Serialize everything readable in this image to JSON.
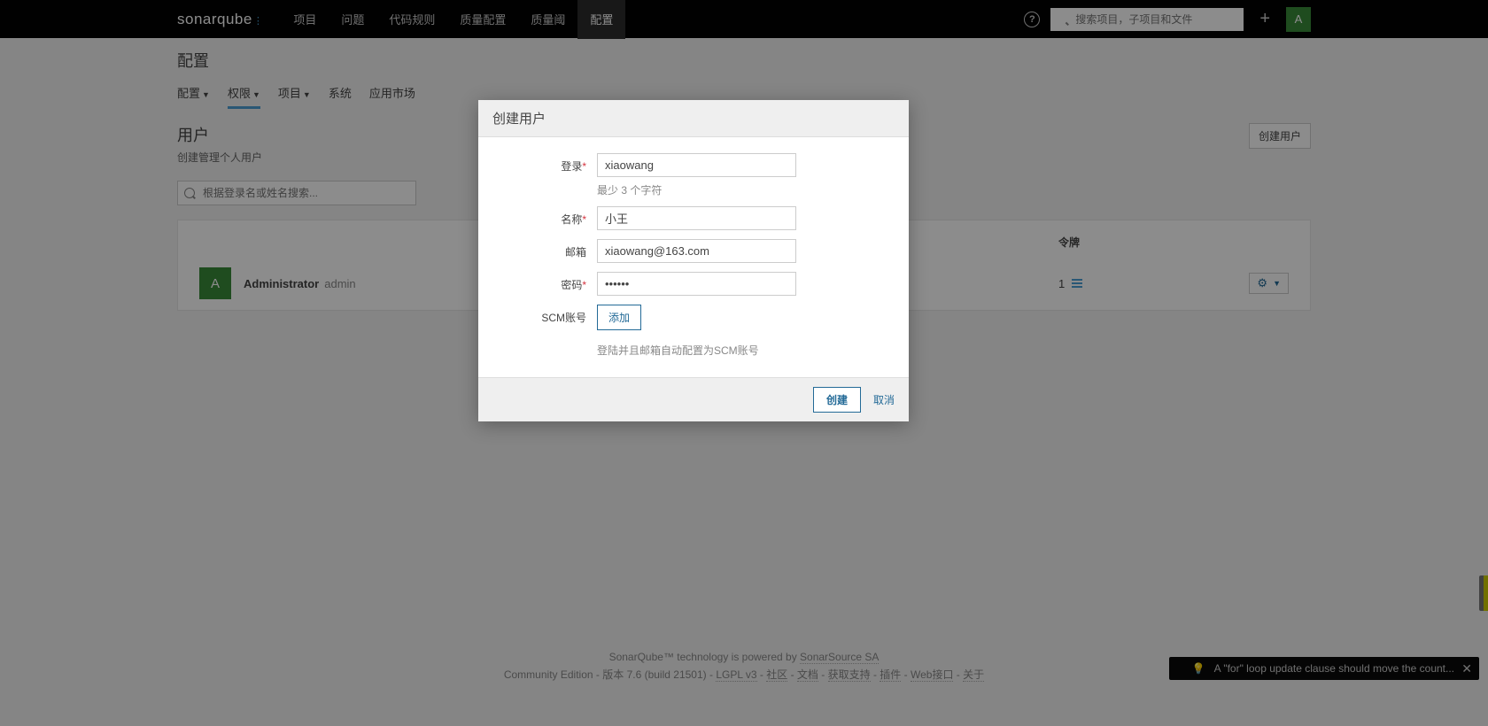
{
  "brand": "sonarqube",
  "nav": {
    "items": [
      "项目",
      "问题",
      "代码规则",
      "质量配置",
      "质量阈",
      "配置"
    ],
    "active_index": 5,
    "search_placeholder": "搜索项目，子项目和文件",
    "avatar_letter": "A"
  },
  "page": {
    "title": "配置",
    "subnav": [
      "配置",
      "权限",
      "项目",
      "系统",
      "应用市场"
    ],
    "subnav_carets": [
      true,
      true,
      true,
      false,
      false
    ],
    "subnav_active": 1
  },
  "users": {
    "heading": "用户",
    "sub": "创建管理个人用户",
    "create_btn": "创建用户",
    "filter_placeholder": "根据登录名或姓名搜索...",
    "col_token": "令牌",
    "row": {
      "avatar": "A",
      "name": "Administrator",
      "login": "admin",
      "tokens": "1"
    }
  },
  "modal": {
    "title": "创建用户",
    "labels": {
      "login": "登录",
      "name": "名称",
      "email": "邮箱",
      "password": "密码",
      "scm": "SCM账号"
    },
    "values": {
      "login": "xiaowang",
      "name": "小王",
      "email": "xiaowang@163.com",
      "password": "••••••"
    },
    "hints": {
      "login": "最少 3 个字符",
      "scm": "登陆并且邮箱自动配置为SCM账号"
    },
    "add_btn": "添加",
    "submit": "创建",
    "cancel": "取消"
  },
  "footer": {
    "line1_pre": "SonarQube™ technology is powered by ",
    "line1_link": "SonarSource SA",
    "edition": "Community Edition",
    "version": "版本 7.6 (build 21501)",
    "links": [
      "LGPL v3",
      "社区",
      "文档",
      "获取支持",
      "插件",
      "Web接口",
      "关于"
    ]
  },
  "toast": {
    "text": "A \"for\" loop update clause should move the count..."
  }
}
